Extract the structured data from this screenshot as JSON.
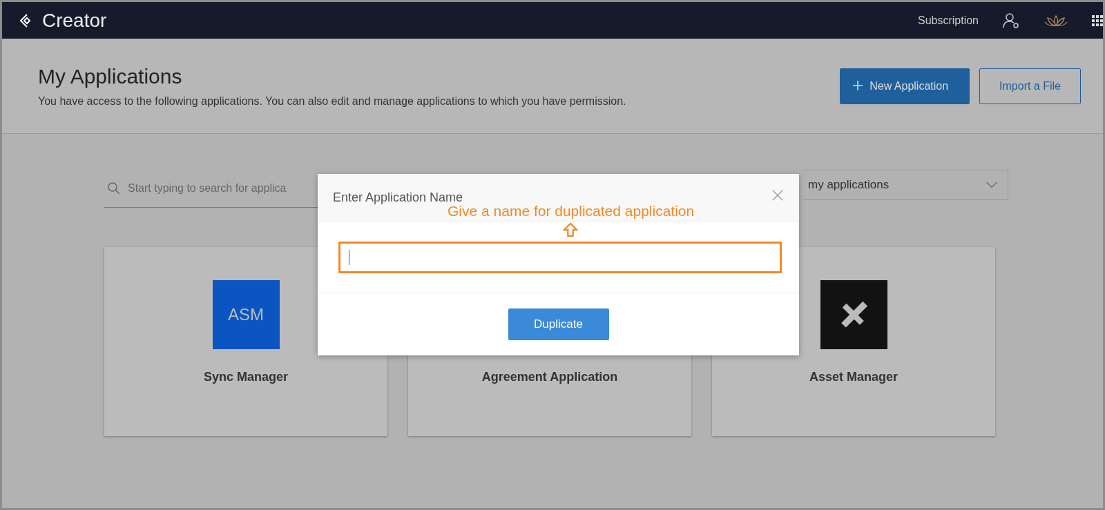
{
  "header": {
    "logo": "Creator",
    "links": [
      "Subscription"
    ]
  },
  "page": {
    "title": "My Applications",
    "subtitle": "You have access to the following applications. You can also edit and manage applications to which you have permission.",
    "buttons": [
      {
        "kind": "primary",
        "label": "New Application"
      },
      {
        "kind": "outline",
        "label": "Import a File"
      }
    ]
  },
  "search": {
    "placeholder": "Start typing to search for applica"
  },
  "filter": {
    "value": "my applications"
  },
  "apps": [
    {
      "name": "Sync Manager",
      "icon": {
        "kind": "text",
        "label": "ASM"
      }
    },
    {
      "name": "Agreement Application",
      "icon": {
        "kind": "covered"
      }
    },
    {
      "name": "Asset Manager",
      "icon": {
        "kind": "tools"
      }
    }
  ],
  "dialog": {
    "title": "Enter Application Name",
    "annotation": "Give a name for duplicated application",
    "button": "Duplicate"
  }
}
